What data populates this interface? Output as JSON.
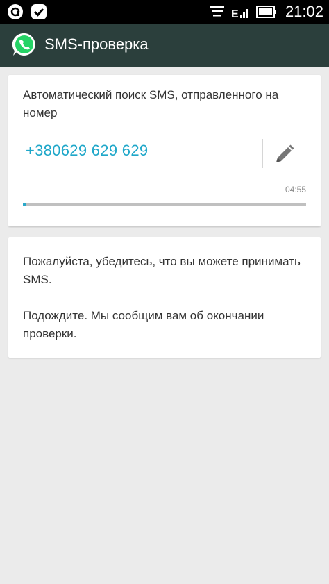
{
  "statusbar": {
    "time": "21:02",
    "network": "E",
    "icons": [
      "app-icon",
      "checkmark-icon",
      "notification-icon",
      "signal-icon",
      "battery-icon"
    ]
  },
  "appbar": {
    "title": "SMS-проверка",
    "logo_icon": "whatsapp-icon",
    "color": "#2b3f3c"
  },
  "verify_card": {
    "description": "Автоматический поиск SMS, отправленного на номер",
    "phone": "+380629 629 629",
    "timer": "04:55",
    "progress": 0.01,
    "edit_icon": "pencil-icon",
    "accent": "#1fa7c9"
  },
  "info_card": {
    "line1": "Пожалуйста, убедитесь, что вы можете принимать SMS.",
    "line2": "Подождите. Мы сообщим вам об окончании проверки."
  }
}
